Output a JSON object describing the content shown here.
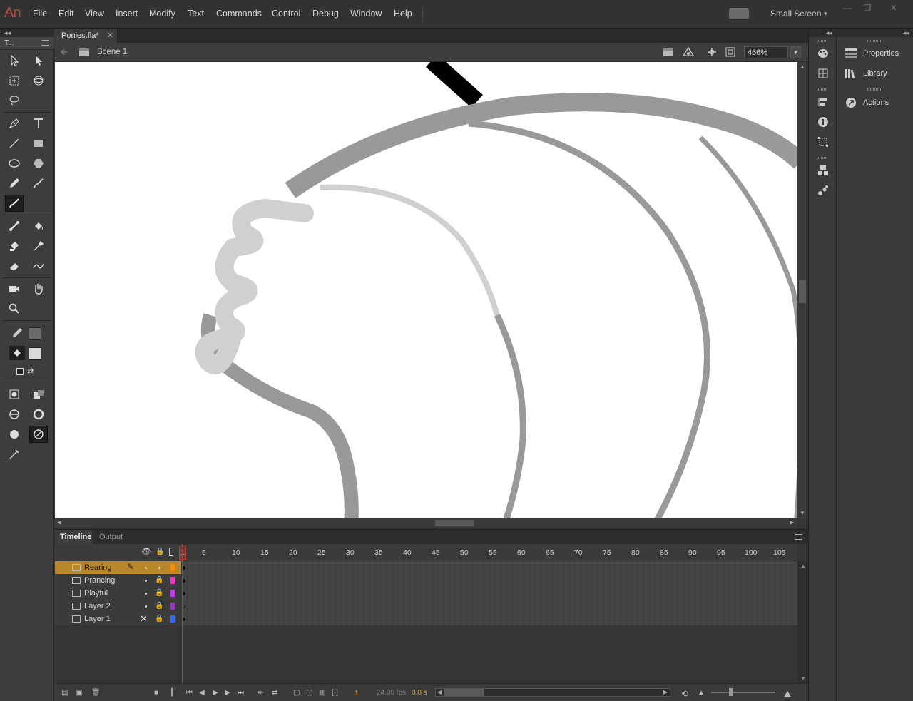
{
  "app": {
    "logo_text": "An",
    "menu": [
      "File",
      "Edit",
      "View",
      "Insert",
      "Modify",
      "Text",
      "Commands",
      "Control",
      "Debug",
      "Window",
      "Help"
    ],
    "workspace": "Small Screen",
    "window_buttons": [
      "minimize",
      "restore",
      "close"
    ]
  },
  "tools_panel": {
    "tab_label": "T...",
    "active_tool": "brush-tool",
    "stroke_color": "#6a6a6a",
    "fill_color": "#d9d9d9"
  },
  "document": {
    "tab_label": "Ponies.fla*",
    "scene_label": "Scene 1",
    "zoom": "466%"
  },
  "stage": {
    "background": "#ffffff",
    "stroke_dark": "#999999",
    "stroke_light": "#d0d0d0",
    "stroke_black": "#000000"
  },
  "timeline": {
    "tabs": [
      "Timeline",
      "Output"
    ],
    "frame_numbers": [
      "1",
      "5",
      "10",
      "15",
      "20",
      "25",
      "30",
      "35",
      "40",
      "45",
      "50",
      "55",
      "60",
      "65",
      "70",
      "75",
      "80",
      "85",
      "90",
      "95",
      "100",
      "105"
    ],
    "layers": [
      {
        "name": "Rearing",
        "color": "#ff8800",
        "selected": true,
        "locked": false
      },
      {
        "name": "Prancing",
        "color": "#ff33cc",
        "selected": false,
        "locked": true
      },
      {
        "name": "Playful",
        "color": "#cc33ff",
        "selected": false,
        "locked": true
      },
      {
        "name": "Layer 2",
        "color": "#9933cc",
        "selected": false,
        "locked": true
      },
      {
        "name": "Layer 1",
        "color": "#3366ff",
        "selected": false,
        "locked": true
      }
    ],
    "current_frame": "1",
    "fps": "24.00 fps",
    "elapsed": "0.0 s"
  },
  "right_panels": {
    "items": [
      "Properties",
      "Library",
      "Actions"
    ]
  }
}
